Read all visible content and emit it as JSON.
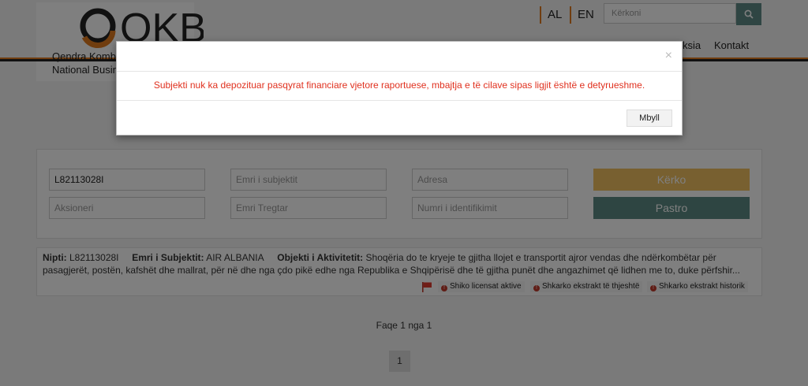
{
  "header": {
    "logo_text": "OKB",
    "logo_line1": "Qendra Kombe",
    "logo_line2": "National Busin",
    "lang_al": "AL",
    "lang_en": "EN",
    "search_placeholder": "Kërkoni",
    "nav_partial": "ksia",
    "nav_contact": "Kontakt"
  },
  "filters": {
    "nipt_value": "L82113028I",
    "subject_name_placeholder": "Emri i subjektit",
    "address_placeholder": "Adresa",
    "shareholder_placeholder": "Aksioneri",
    "trade_name_placeholder": "Emri Tregtar",
    "id_number_placeholder": "Numri i identifikimit",
    "search_label": "Kërko",
    "clear_label": "Pastro"
  },
  "result": {
    "nipt_label": "Nipti:",
    "nipt_value": "L82113028I",
    "name_label": "Emri i Subjektit:",
    "name_value": "AIR ALBANIA",
    "activity_label": "Objekti i Aktivitetit:",
    "activity_value": "Shoqëria do te kryeje te gjitha llojet e transportit ajror vendas dhe ndërkombëtar për pasagjerët, postën, kafshët dhe mallrat, për në dhe nga çdo pikë edhe nga Republika e Shqipërisë dhe të gjitha punët dhe angazhimet që lidhen me to, duke përfshir...",
    "action_licenses": "Shiko licensat aktive",
    "action_simple_extract": "Shkarko ekstrakt të thjeshtë",
    "action_history_extract": "Shkarko ekstrakt historik",
    "action_icon_glyph": "!"
  },
  "pagination": {
    "text": "Faqe 1 nga 1",
    "current_page": "1"
  },
  "modal": {
    "close_symbol": "×",
    "message": "Subjekti nuk ka depozituar pasqyrat financiare vjetore raportuese, mbajtja e të cilave sipas ligjit është e detyrueshme.",
    "close_button": "Mbyll"
  },
  "colors": {
    "accent_orange": "#e07a1f",
    "search_button": "#f0c060",
    "clear_button": "#5c8b84",
    "error_text": "#e0301e"
  }
}
